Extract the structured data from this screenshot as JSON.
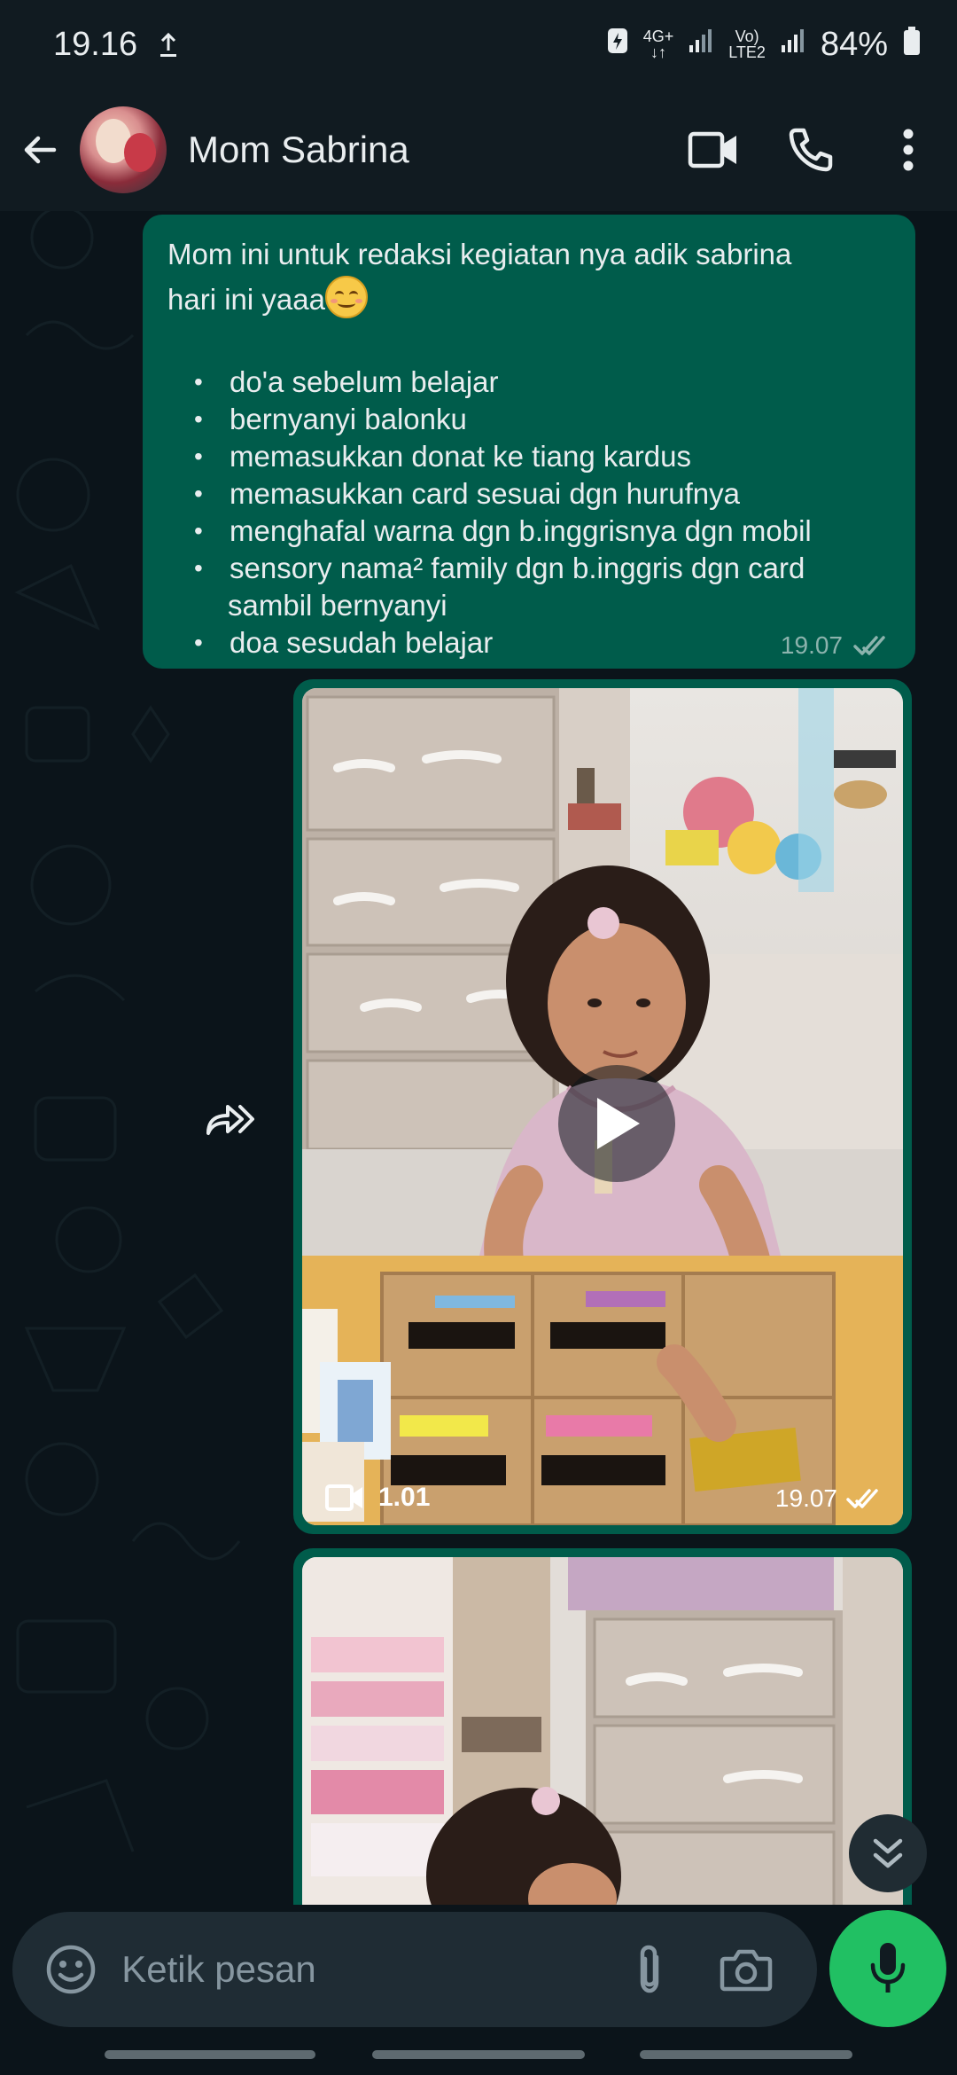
{
  "status_bar": {
    "time": "19.16",
    "network_1_top": "4G+",
    "network_1_bottom": "↓↑",
    "network_2_top": "Vo)",
    "network_2_bottom": "LTE2",
    "battery": "84%"
  },
  "header": {
    "contact_name": "Mom Sabrina",
    "icons": [
      "back-arrow-icon",
      "video-call-icon",
      "voice-call-icon",
      "more-vert-icon"
    ]
  },
  "messages": [
    {
      "type": "text",
      "intro_line1": "Mom ini untuk redaksi kegiatan nya adik sabrina",
      "intro_line2": "hari ini yaaa",
      "emoji": "smiling-face-emoji",
      "items": [
        "do'a sebelum belajar",
        "bernyanyi balonku",
        "memasukkan donat ke tiang kardus",
        "memasukkan card sesuai dgn hurufnya",
        "menghafal warna dgn b.inggrisnya dgn mobil",
        "sensory nama² family dgn b.inggris  dgn card",
        "doa sesudah belajar"
      ],
      "item_6_continuation": "sambil bernyanyi",
      "time": "19.07",
      "status": "delivered"
    },
    {
      "type": "video",
      "duration": "1.01",
      "time": "19.07",
      "status": "delivered"
    },
    {
      "type": "video",
      "partial": true
    }
  ],
  "input": {
    "placeholder": "Ketik pesan"
  },
  "colors": {
    "outgoing_bubble": "#005c4b",
    "background": "#0b141a",
    "header": "#111b21",
    "mic_button": "#21c063"
  }
}
